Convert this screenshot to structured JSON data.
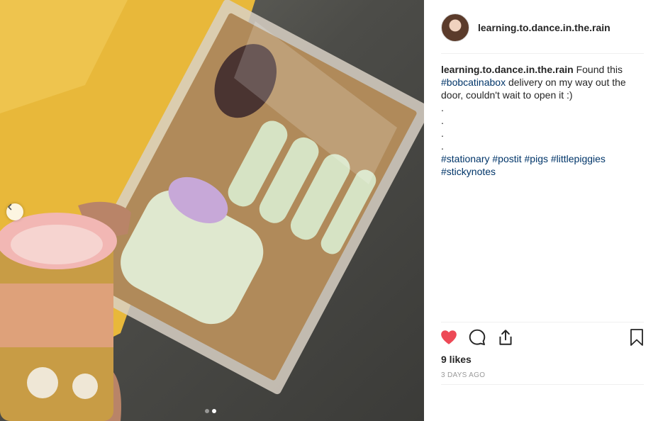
{
  "post": {
    "username": "learning.to.dance.in.the.rain",
    "caption": {
      "username": "learning.to.dance.in.the.rain",
      "text_before": " Found this ",
      "hashtag_1": "#bobcatinabox",
      "text_after": " delivery on my way out the door, couldn't wait to open it :)",
      "dots": [
        ".",
        ".",
        ".",
        "."
      ],
      "tags": [
        "#stationary",
        "#postit",
        "#pigs",
        "#littlepiggies",
        "#stickynotes"
      ]
    },
    "likes": "9 likes",
    "timestamp": "3 DAYS AGO"
  },
  "carousel": {
    "slide_count": 2,
    "active_index": 1
  },
  "colors": {
    "heart": "#ed4956",
    "hashtag": "#003569",
    "muted": "#999999",
    "border": "#efefef"
  },
  "icons": {
    "like": "heart-icon",
    "comment": "comment-icon",
    "share": "share-icon",
    "save": "bookmark-icon",
    "prev": "chevron-left-icon"
  }
}
